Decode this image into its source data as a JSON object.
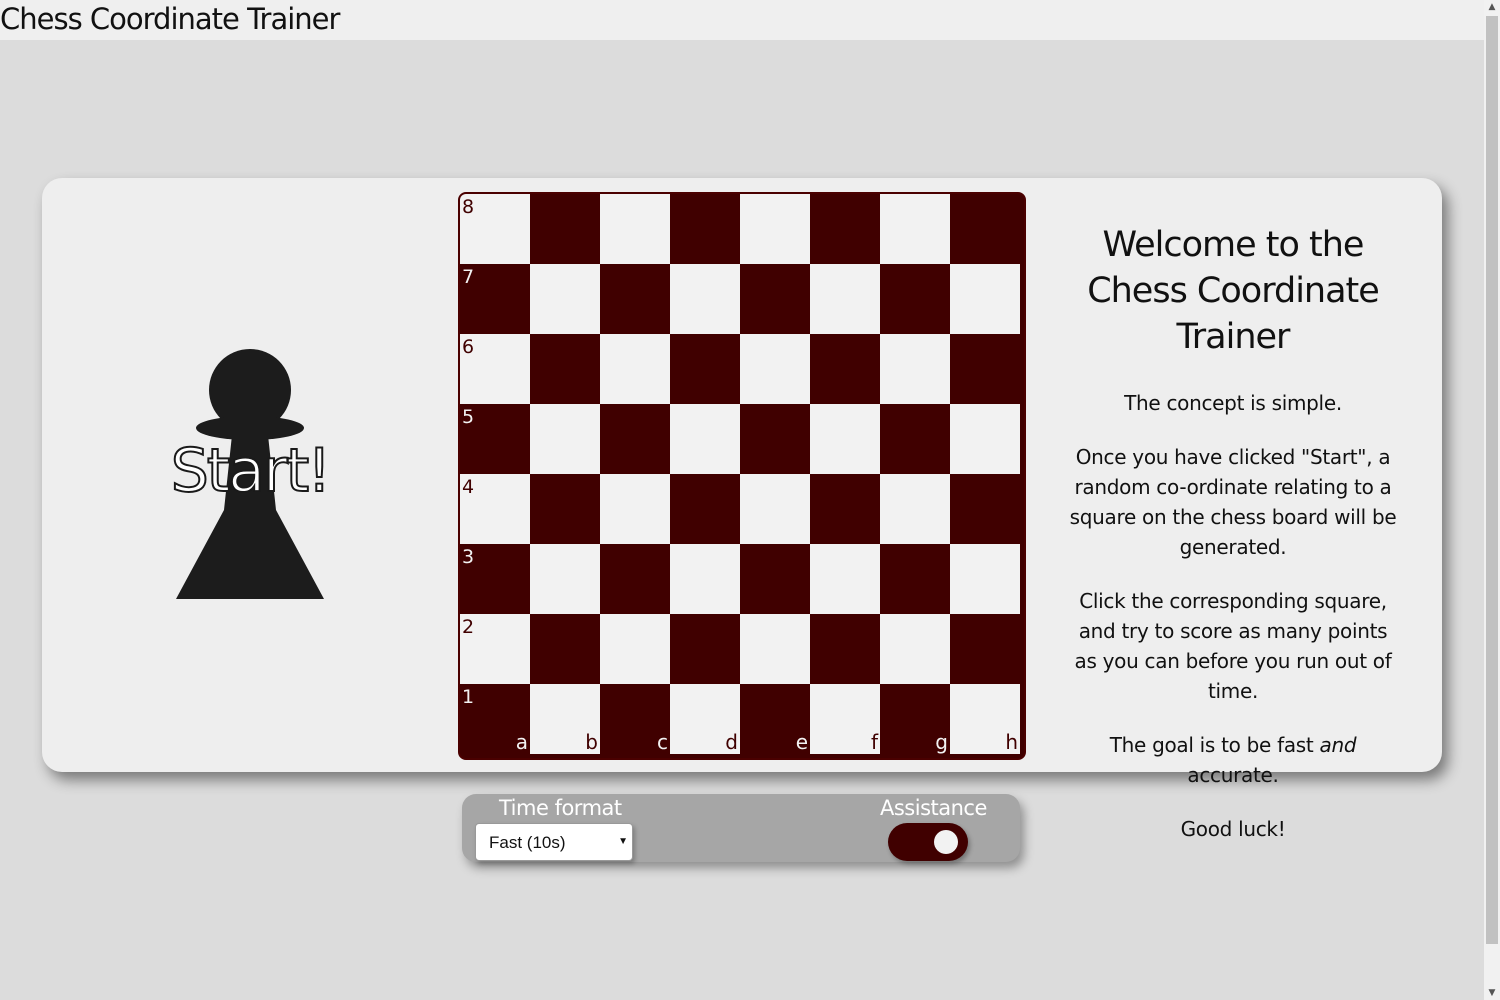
{
  "app": {
    "title": "Chess Coordinate Trainer"
  },
  "start": {
    "label": "Start!",
    "icon": "pawn-icon"
  },
  "board": {
    "ranks": [
      "8",
      "7",
      "6",
      "5",
      "4",
      "3",
      "2",
      "1"
    ],
    "files": [
      "a",
      "b",
      "c",
      "d",
      "e",
      "f",
      "g",
      "h"
    ],
    "light_color": "#f2f2f2",
    "dark_color": "#400000"
  },
  "info": {
    "title": "Welcome to the Chess Coordinate Trainer",
    "p1": "The concept is simple.",
    "p2": "Once you have clicked \"Start\", a random co-ordinate relating to a square on the chess board will be generated.",
    "p3": "Click the corresponding square, and try to score as many points as you can before you run out of time.",
    "p4_before": "The goal is to be fast ",
    "p4_em": "and",
    "p4_after": " accurate.",
    "p5": "Good luck!"
  },
  "controls": {
    "time_format_label": "Time format",
    "time_format_value": "Fast (10s)",
    "assistance_label": "Assistance",
    "assistance_on": true
  }
}
